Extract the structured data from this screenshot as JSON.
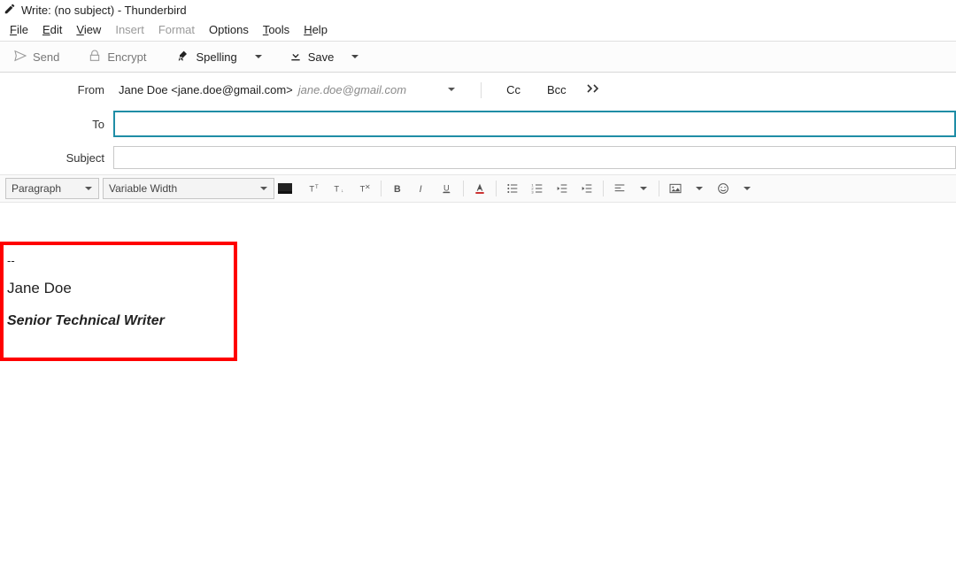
{
  "window": {
    "title": "Write: (no subject) - Thunderbird"
  },
  "menu": {
    "file": "File",
    "edit": "Edit",
    "view": "View",
    "insert": "Insert",
    "format": "Format",
    "options": "Options",
    "tools": "Tools",
    "help": "Help"
  },
  "toolbar": {
    "send": "Send",
    "encrypt": "Encrypt",
    "spelling": "Spelling",
    "save": "Save"
  },
  "headers": {
    "from_label": "From",
    "from_identity": "Jane Doe <jane.doe@gmail.com>",
    "from_account": "jane.doe@gmail.com",
    "to_label": "To",
    "to_value": "",
    "subject_label": "Subject",
    "subject_value": "",
    "cc": "Cc",
    "bcc": "Bcc"
  },
  "format": {
    "paragraph": "Paragraph",
    "font": "Variable Width"
  },
  "signature": {
    "dashes": "--",
    "name": "Jane Doe",
    "title": "Senior Technical Writer"
  }
}
